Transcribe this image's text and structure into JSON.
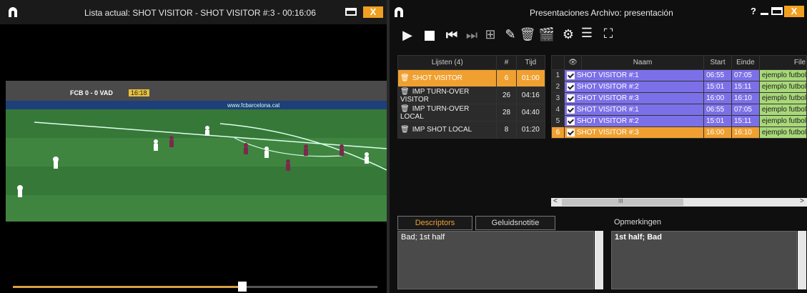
{
  "left_window": {
    "title": "Lista actual: SHOT VISITOR - SHOT VISITOR #:3 - 00:16:06",
    "close_label": "X",
    "video": {
      "scoreboard": "FCB 0 - 0 VAD",
      "clock": "16:18",
      "ad_text": "www.fcbarcelona.cat"
    },
    "seek_progress": 0.63
  },
  "right_window": {
    "title": "Presentaciones Archivo: presentación",
    "help_label": "?",
    "close_label": "X",
    "lists": {
      "headers": [
        "Lijsten (4)",
        "#",
        "Tijd"
      ],
      "rows": [
        {
          "name": "SHOT VISITOR",
          "count": "6",
          "time": "01:00",
          "selected": true
        },
        {
          "name": "IMP TURN-OVER VISITOR",
          "count": "26",
          "time": "04:16",
          "selected": false
        },
        {
          "name": "IMP TURN-OVER LOCAL",
          "count": "28",
          "time": "04:40",
          "selected": false
        },
        {
          "name": "IMP SHOT LOCAL",
          "count": "8",
          "time": "01:20",
          "selected": false
        }
      ]
    },
    "clips": {
      "headers": [
        "",
        "",
        "Naam",
        "Start",
        "Einde",
        "File"
      ],
      "rows": [
        {
          "num": "1",
          "name": "SHOT VISITOR #:1",
          "start": "06:55",
          "end": "07:05",
          "file": "ejemplo futbol ."
        },
        {
          "num": "2",
          "name": "SHOT VISITOR #:2",
          "start": "15:01",
          "end": "15:11",
          "file": "ejemplo futbol ."
        },
        {
          "num": "3",
          "name": "SHOT VISITOR #:3",
          "start": "16:00",
          "end": "16:10",
          "file": "ejemplo futbol ."
        },
        {
          "num": "4",
          "name": "SHOT VISITOR #:1",
          "start": "06:55",
          "end": "07:05",
          "file": "ejemplo futbol ."
        },
        {
          "num": "5",
          "name": "SHOT VISITOR #:2",
          "start": "15:01",
          "end": "15:11",
          "file": "ejemplo futbol ."
        },
        {
          "num": "6",
          "name": "SHOT VISITOR #:3",
          "start": "16:00",
          "end": "16:10",
          "file": "ejemplo futbol"
        }
      ],
      "selected_index": 5,
      "hscroll_left": "<",
      "hscroll_mid": "III",
      "hscroll_right": ">"
    },
    "tabs": {
      "descriptors": "Descriptors",
      "audio_note": "Geluidsnotitie",
      "remarks_label": "Opmerkingen"
    },
    "descriptors_text": "Bad; 1st half",
    "remarks_text": "1st half; Bad",
    "colors": {
      "accent": "#f0a030",
      "clip_row": "#7c70e8",
      "file_cell": "#a8d878"
    }
  }
}
